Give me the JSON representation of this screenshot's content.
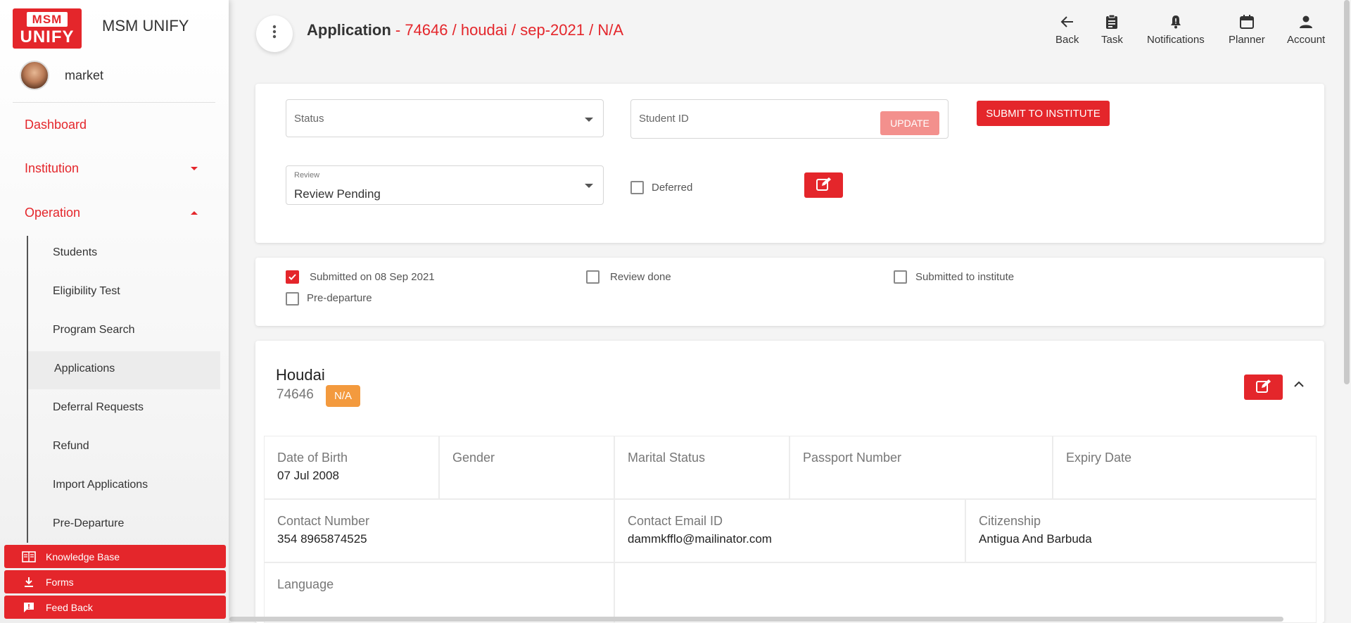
{
  "brand": {
    "logo_top": "MSM",
    "logo_bottom": "UNIFY",
    "title": "MSM UNIFY"
  },
  "user": {
    "name": "market"
  },
  "nav": {
    "dashboard": "Dashboard",
    "institution": "Institution",
    "operation": "Operation",
    "sub_items": [
      "Students",
      "Eligibility Test",
      "Program Search",
      "Applications",
      "Deferral Requests",
      "Refund",
      "Import Applications",
      "Pre-Departure"
    ],
    "active_sub": "Applications"
  },
  "bottom_buttons": {
    "knowledge_base": "Knowledge Base",
    "forms": "Forms",
    "feedback": "Feed Back"
  },
  "header": {
    "title_prefix": "Application",
    "title_detail": " - 74646 / houdai / sep-2021 / N/A",
    "actions": {
      "back": "Back",
      "task": "Task",
      "notifications": "Notifications",
      "planner": "Planner",
      "account": "Account"
    }
  },
  "status_card": {
    "status_placeholder": "Status",
    "student_id_placeholder": "Student ID",
    "update_label": "UPDATE",
    "submit_label": "SUBMIT TO INSTITUTE",
    "review_label": "Review",
    "review_value": "Review Pending",
    "deferred_label": "Deferred"
  },
  "progress": {
    "submitted_on": "Submitted on 08 Sep 2021",
    "review_done": "Review done",
    "submitted_to_institute": "Submitted to institute",
    "pre_departure": "Pre-departure",
    "submitted_checked": true
  },
  "student": {
    "name": "Houdai",
    "id": "74646",
    "badge": "N/A",
    "fields": {
      "dob_label": "Date of Birth",
      "dob": "07 Jul 2008",
      "gender_label": "Gender",
      "marital_label": "Marital Status",
      "passport_label": "Passport Number",
      "expiry_label": "Expiry Date",
      "contact_label": "Contact Number",
      "contact": "354 8965874525",
      "email_label": "Contact Email ID",
      "email": "dammkfflo@mailinator.com",
      "citizenship_label": "Citizenship",
      "citizenship": "Antigua And Barbuda",
      "language_label": "Language"
    }
  },
  "colors": {
    "accent": "#e4262b",
    "badge": "#f39a3e",
    "update_disabled": "#f3908d"
  }
}
